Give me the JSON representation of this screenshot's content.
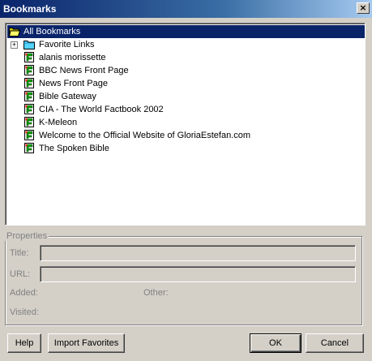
{
  "window": {
    "title": "Bookmarks",
    "close_glyph": "×"
  },
  "tree": {
    "root": {
      "label": "All Bookmarks",
      "icon": "open-folder-icon",
      "selected": true
    },
    "folders": [
      {
        "label": "Favorite Links",
        "icon": "folder-icon",
        "expander": "+"
      }
    ],
    "bookmarks": [
      {
        "label": "alanis morissette",
        "icon": "bookmark-icon"
      },
      {
        "label": "BBC News Front Page",
        "icon": "bookmark-icon"
      },
      {
        "label": "News Front Page",
        "icon": "bookmark-icon"
      },
      {
        "label": "Bible Gateway",
        "icon": "bookmark-icon"
      },
      {
        "label": "CIA - The World Factbook 2002",
        "icon": "bookmark-icon"
      },
      {
        "label": "K-Meleon",
        "icon": "bookmark-icon"
      },
      {
        "label": "Welcome to the Official Website of GloriaEstefan.com",
        "icon": "bookmark-icon"
      },
      {
        "label": "The Spoken Bible",
        "icon": "bookmark-icon"
      }
    ]
  },
  "properties": {
    "group_label": "Properties",
    "title_label": "Title:",
    "title_value": "",
    "url_label": "URL:",
    "url_value": "",
    "added_label": "Added:",
    "other_label": "Other:",
    "visited_label": "Visited:"
  },
  "buttons": {
    "help": "Help",
    "import": "Import Favorites",
    "ok": "OK",
    "cancel": "Cancel"
  },
  "colors": {
    "selection": "#0a246a",
    "face": "#d4d0c8",
    "titlebar_start": "#0a246a",
    "titlebar_end": "#a6caf0"
  }
}
